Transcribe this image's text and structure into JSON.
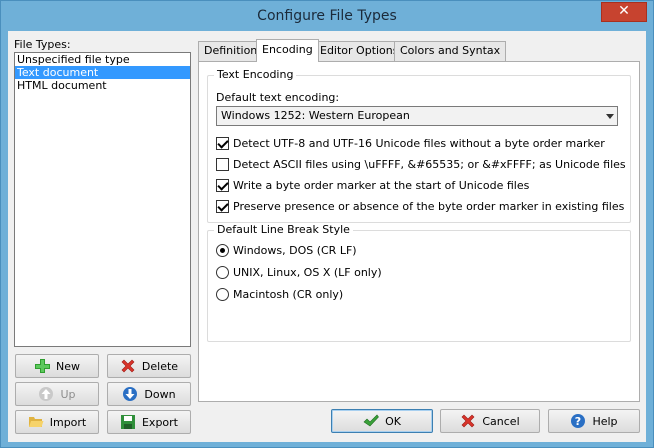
{
  "window": {
    "title": "Configure File Types",
    "close_glyph": "✕"
  },
  "file_types": {
    "label": "File Types:",
    "items": [
      {
        "label": "Unspecified file type",
        "selected": false
      },
      {
        "label": "Text document",
        "selected": true
      },
      {
        "label": "HTML document",
        "selected": false
      }
    ]
  },
  "left_buttons": {
    "new": {
      "label": "New",
      "icon": "plus-icon"
    },
    "delete": {
      "label": "Delete",
      "icon": "x-icon"
    },
    "up": {
      "label": "Up",
      "icon": "arrow-up-icon",
      "disabled": true
    },
    "down": {
      "label": "Down",
      "icon": "arrow-down-icon"
    },
    "import": {
      "label": "Import",
      "icon": "folder-open-icon"
    },
    "export": {
      "label": "Export",
      "icon": "save-icon"
    }
  },
  "tabs": [
    {
      "label": "Definition",
      "active": false
    },
    {
      "label": "Encoding",
      "active": true
    },
    {
      "label": "Editor Options",
      "active": false
    },
    {
      "label": "Colors and Syntax",
      "active": false
    }
  ],
  "text_encoding": {
    "group_title": "Text Encoding",
    "default_label": "Default text encoding:",
    "default_value": "Windows 1252: Western European",
    "options": [
      {
        "label": "Detect UTF-8 and UTF-16 Unicode files without a byte order marker",
        "checked": true
      },
      {
        "label": "Detect ASCII files using \\uFFFF, &#65535; or &#xFFFF; as Unicode files",
        "checked": false
      },
      {
        "label": "Write a byte order marker at the start of Unicode files",
        "checked": true
      },
      {
        "label": "Preserve presence or absence of the byte order marker in existing files",
        "checked": true
      }
    ]
  },
  "line_break": {
    "group_title": "Default Line Break Style",
    "options": [
      {
        "label": "Windows, DOS (CR LF)",
        "checked": true
      },
      {
        "label": "UNIX, Linux, OS X (LF only)",
        "checked": false
      },
      {
        "label": "Macintosh (CR only)",
        "checked": false
      }
    ]
  },
  "dialog_buttons": {
    "ok": {
      "label": "OK",
      "icon": "checkmark-icon"
    },
    "cancel": {
      "label": "Cancel",
      "icon": "x-icon"
    },
    "help": {
      "label": "Help",
      "icon": "help-icon"
    }
  },
  "colors": {
    "selection": "#3399ff",
    "titlebar": "#6fb0d8",
    "close": "#c7432f"
  }
}
